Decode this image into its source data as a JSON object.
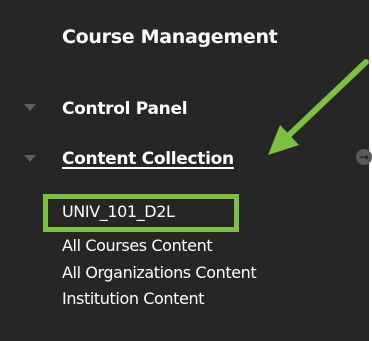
{
  "sidebar": {
    "heading": "Course Management",
    "sections": [
      {
        "label": "Control Panel",
        "expanded": false
      },
      {
        "label": "Content Collection",
        "expanded": true
      }
    ],
    "content_collection_items": [
      {
        "label": "UNIV_101_D2L",
        "highlighted": true
      },
      {
        "label": "All Courses Content"
      },
      {
        "label": "All Organizations Content"
      },
      {
        "label": "Institution Content"
      }
    ]
  },
  "annotation": {
    "color": "#7cc142",
    "icons": [
      "arrow-icon",
      "highlight-box"
    ]
  },
  "colors": {
    "panel_background": "#262626",
    "text": "#ffffff",
    "triangle": "#5e5e5e"
  }
}
